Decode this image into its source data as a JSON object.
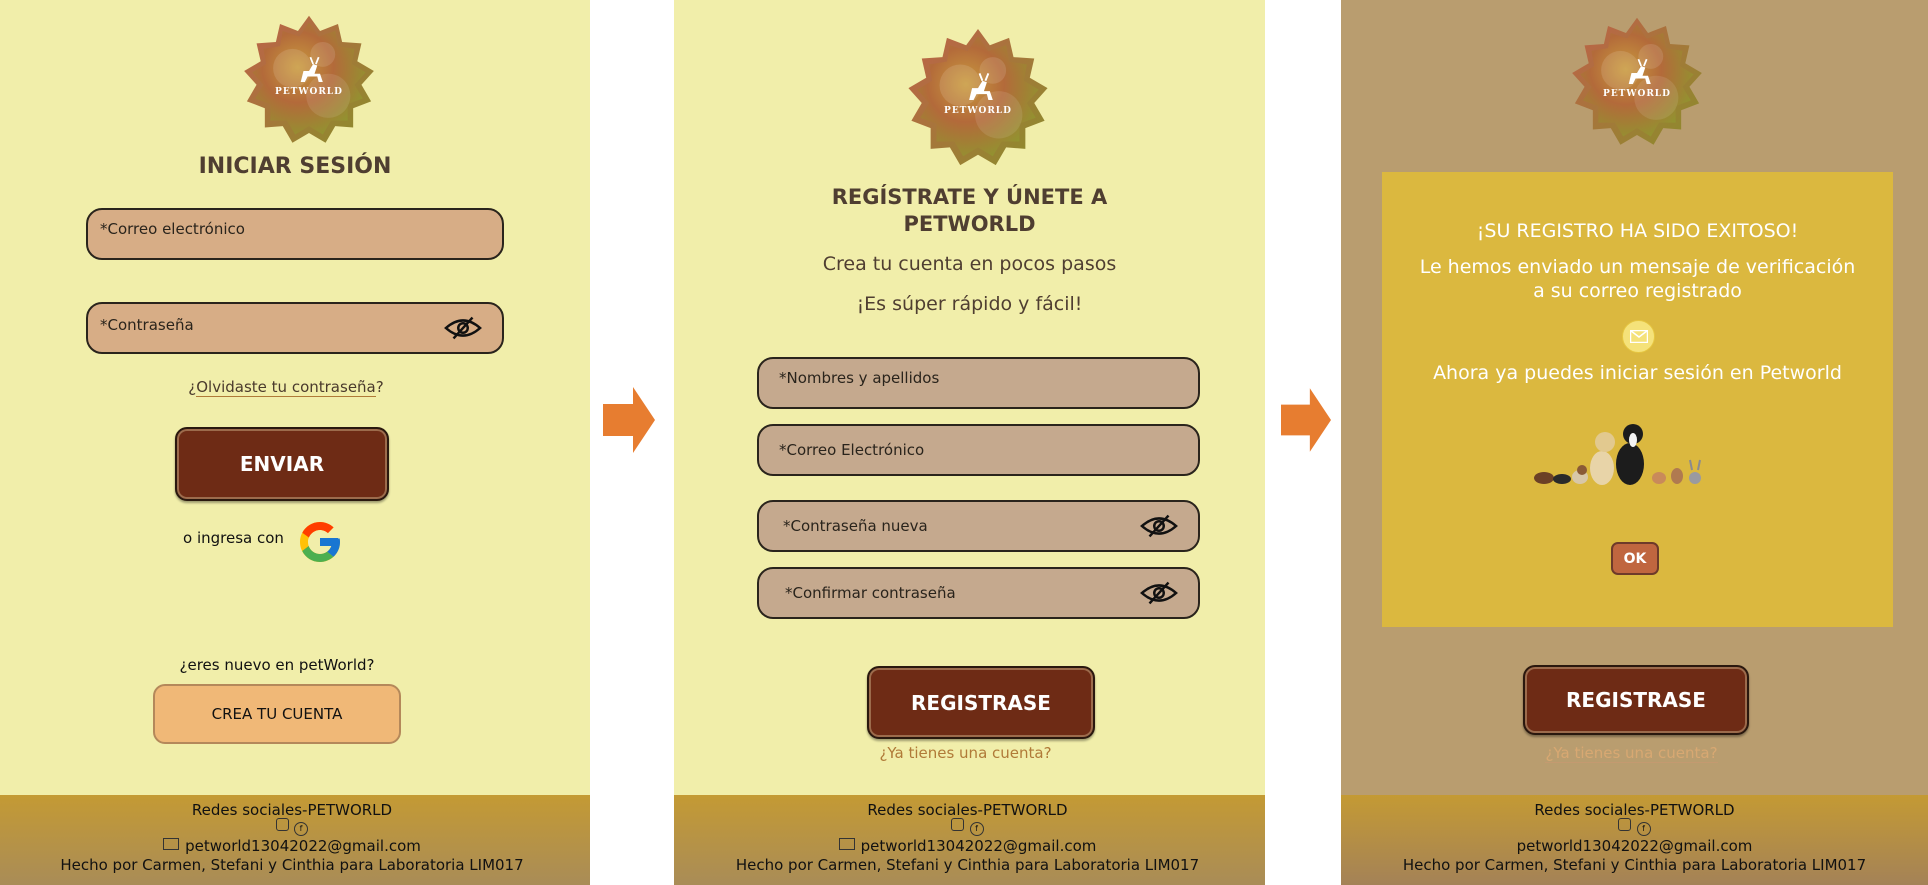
{
  "brand": {
    "logo_text": "PETWORLD"
  },
  "login": {
    "title": "INICIAR SESIÓN",
    "email_placeholder": "*Correo electrónico",
    "password_placeholder": "*Contraseña",
    "forgot_prefix": "¿",
    "forgot_link": "Olvidaste tu contraseña",
    "forgot_suffix": "?",
    "submit_label": "ENVIAR",
    "alt_login_text": "o ingresa con",
    "new_user_text": "¿eres nuevo en petWorld?",
    "create_account_label": "CREA TU CUENTA"
  },
  "register": {
    "title_line1": "REGÍSTRATE Y ÚNETE A",
    "title_line2": "PETWORLD",
    "subtitle": "Crea tu cuenta en pocos pasos",
    "tagline": "¡Es súper rápido y fácil!",
    "name_placeholder": "*Nombres y apellidos",
    "email_placeholder": "*Correo Electrónico",
    "password_placeholder": "*Contraseña nueva",
    "confirm_placeholder": "*Confirmar contraseña",
    "submit_label": "REGISTRASE",
    "have_account_link": "¿Ya tienes una cuenta?"
  },
  "success_modal": {
    "heading": "¡SU  REGISTRO HA SIDO EXITOSO!",
    "message_line1": "Le hemos enviado un mensaje de verificación",
    "message_line2": "a su correo registrado",
    "login_prompt": "Ahora ya puedes iniciar sesión en  Petworld",
    "ok_label": "OK"
  },
  "footer": {
    "social_title": "Redes sociales-PETWORLD",
    "social_icons": "instagram-icon, facebook-icon",
    "email": "petworld13042022@gmail.com",
    "credits": "Hecho por Carmen, Stefani y Cinthia para Laboratoria LIM017"
  },
  "colors": {
    "background": "#f1eeaa",
    "dimmed_background": "#b99d6f",
    "login_input": "#d7ad86",
    "register_input": "#c5a98e",
    "primary_button": "#6e2b15",
    "secondary_button": "#f0b877",
    "link": "#b07a38",
    "modal": "#dbb83f",
    "ok_button": "#c0663f",
    "footer": "#c49a34",
    "arrow": "#e77d30"
  }
}
